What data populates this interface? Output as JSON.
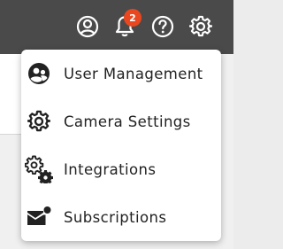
{
  "header": {
    "notifications": {
      "count": "2"
    },
    "icons": [
      "account-circle-icon",
      "bell-icon",
      "help-circle-icon",
      "gear-icon"
    ]
  },
  "menu": {
    "items": [
      {
        "label": "User Management",
        "icon": "user-management-icon"
      },
      {
        "label": "Camera Settings",
        "icon": "gear-icon"
      },
      {
        "label": "Integrations",
        "icon": "gears-icon"
      },
      {
        "label": "Subscriptions",
        "icon": "mail-notification-icon"
      }
    ]
  },
  "colors": {
    "topbar": "#4a4a4a",
    "badge": "#e8471f",
    "icon": "#ffffff",
    "menu_text": "#222222"
  }
}
